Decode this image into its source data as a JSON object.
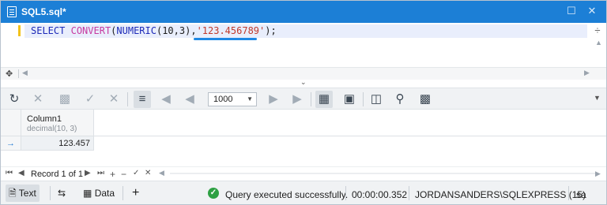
{
  "window": {
    "title": "SQL5.sql*",
    "controls": {
      "restore": "☐",
      "close": "✕"
    }
  },
  "editor": {
    "code": {
      "kw1": "SELECT",
      "fn": "CONVERT",
      "p1": "(",
      "kw2": "NUMERIC",
      "p2": "(10,3),",
      "str": "'123.456789'",
      "p3": ");"
    }
  },
  "toolbar": {
    "icons": [
      "refresh-icon",
      "cancel-icon",
      "save-changes-icon",
      "apply-icon",
      "discard-icon",
      "fetch-all-icon",
      "first-page-icon",
      "previous-page-icon",
      "next-page-icon",
      "last-page-icon",
      "grid-view-icon",
      "card-view-icon",
      "columns-icon",
      "find-icon",
      "export-icon"
    ],
    "row_limit": "1000"
  },
  "grid": {
    "columns": [
      {
        "name": "Column1",
        "type": "decimal(10, 3)"
      }
    ],
    "rows": [
      [
        "123.457"
      ]
    ],
    "row_indicator": "→"
  },
  "navigator": {
    "record_text": "Record 1 of 1"
  },
  "statusbar": {
    "text_tab": "Text",
    "data_tab": "Data",
    "add_label": "+",
    "message": "Query executed successfully.",
    "elapsed": "00:00:00.352",
    "connection": "JORDANSANDERS\\SQLEXPRESS (15)",
    "user": "sa"
  },
  "colors": {
    "titlebar": "#1c7fd6",
    "keyword": "#1d2ab8",
    "function": "#c73aa0",
    "string": "#c0392b",
    "success": "#2ea043"
  }
}
